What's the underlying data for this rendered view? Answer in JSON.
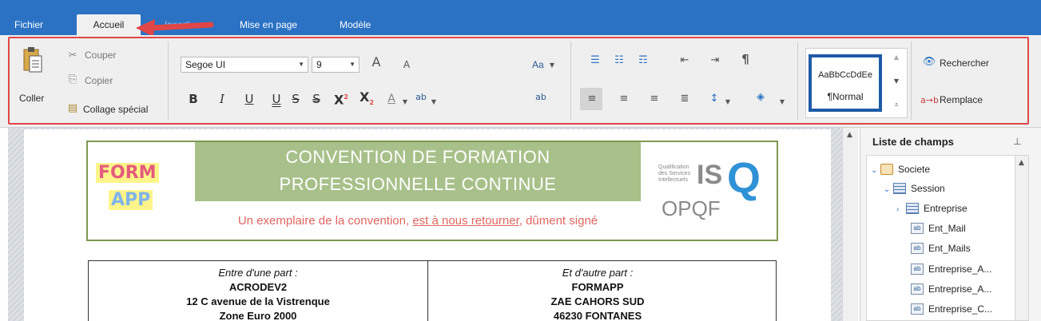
{
  "tabs": {
    "fichier": "Fichier",
    "accueil": "Accueil",
    "insertion": "Insertion",
    "mise_en_page": "Mise en page",
    "modele": "Modèle"
  },
  "clipboard": {
    "coller": "Coller",
    "couper": "Couper",
    "copier": "Copier",
    "collage_special": "Collage spécial"
  },
  "font": {
    "family": "Segoe UI",
    "size": "9",
    "grow_icon": "A",
    "shrink_icon": "A",
    "case_label": "Aa",
    "bold": "B",
    "italic": "I",
    "underline": "U",
    "double_underline": "U",
    "strike": "S",
    "double_strike": "S",
    "superscript": "X",
    "subscript": "X",
    "font_color": "A",
    "highlight": "ab",
    "clear_format": "ab"
  },
  "styles": {
    "preview": "AaBbCcDdEe",
    "name": "¶Normal"
  },
  "editing": {
    "rechercher": "Rechercher",
    "remplacer": "Remplace"
  },
  "document": {
    "title_line1": "CONVENTION DE FORMATION",
    "title_line2": "PROFESSIONNELLE CONTINUE",
    "subtitle_a": "Un exemplaire de la convention, ",
    "subtitle_b": "est à nous retourner",
    "subtitle_c": ", dûment signé",
    "logo_form_top": "FORM",
    "logo_form_bottom": "APP",
    "isq_small": "Qualification des Services Intellectuels",
    "isq_big": "IS",
    "isq_q": "Q",
    "isq_opqf": "OPQF",
    "left_party": {
      "label": "Entre d'une part :",
      "name": "ACRODEV2",
      "address": "12 C avenue de la Vistrenque",
      "zone": "Zone Euro 2000"
    },
    "right_party": {
      "label": "Et d'autre part :",
      "name": "FORMAPP",
      "address": "ZAE CAHORS SUD",
      "city": "46230 FONTANES"
    }
  },
  "field_list": {
    "title": "Liste de champs",
    "items": [
      {
        "label": "Societe",
        "type": "db"
      },
      {
        "label": "Session",
        "type": "table"
      },
      {
        "label": "Entreprise",
        "type": "table"
      },
      {
        "label": "Ent_Mail",
        "type": "field"
      },
      {
        "label": "Ent_Mails",
        "type": "field"
      },
      {
        "label": "Entreprise_A...",
        "type": "field"
      },
      {
        "label": "Entreprise_A...",
        "type": "field"
      },
      {
        "label": "Entreprise_C...",
        "type": "field"
      }
    ]
  },
  "colors": {
    "tabbar": "#2b72c4",
    "highlight_box": "#e04646",
    "title_band": "#a8c08a",
    "subtitle": "#e06660",
    "style_border": "#1f5aa6"
  }
}
